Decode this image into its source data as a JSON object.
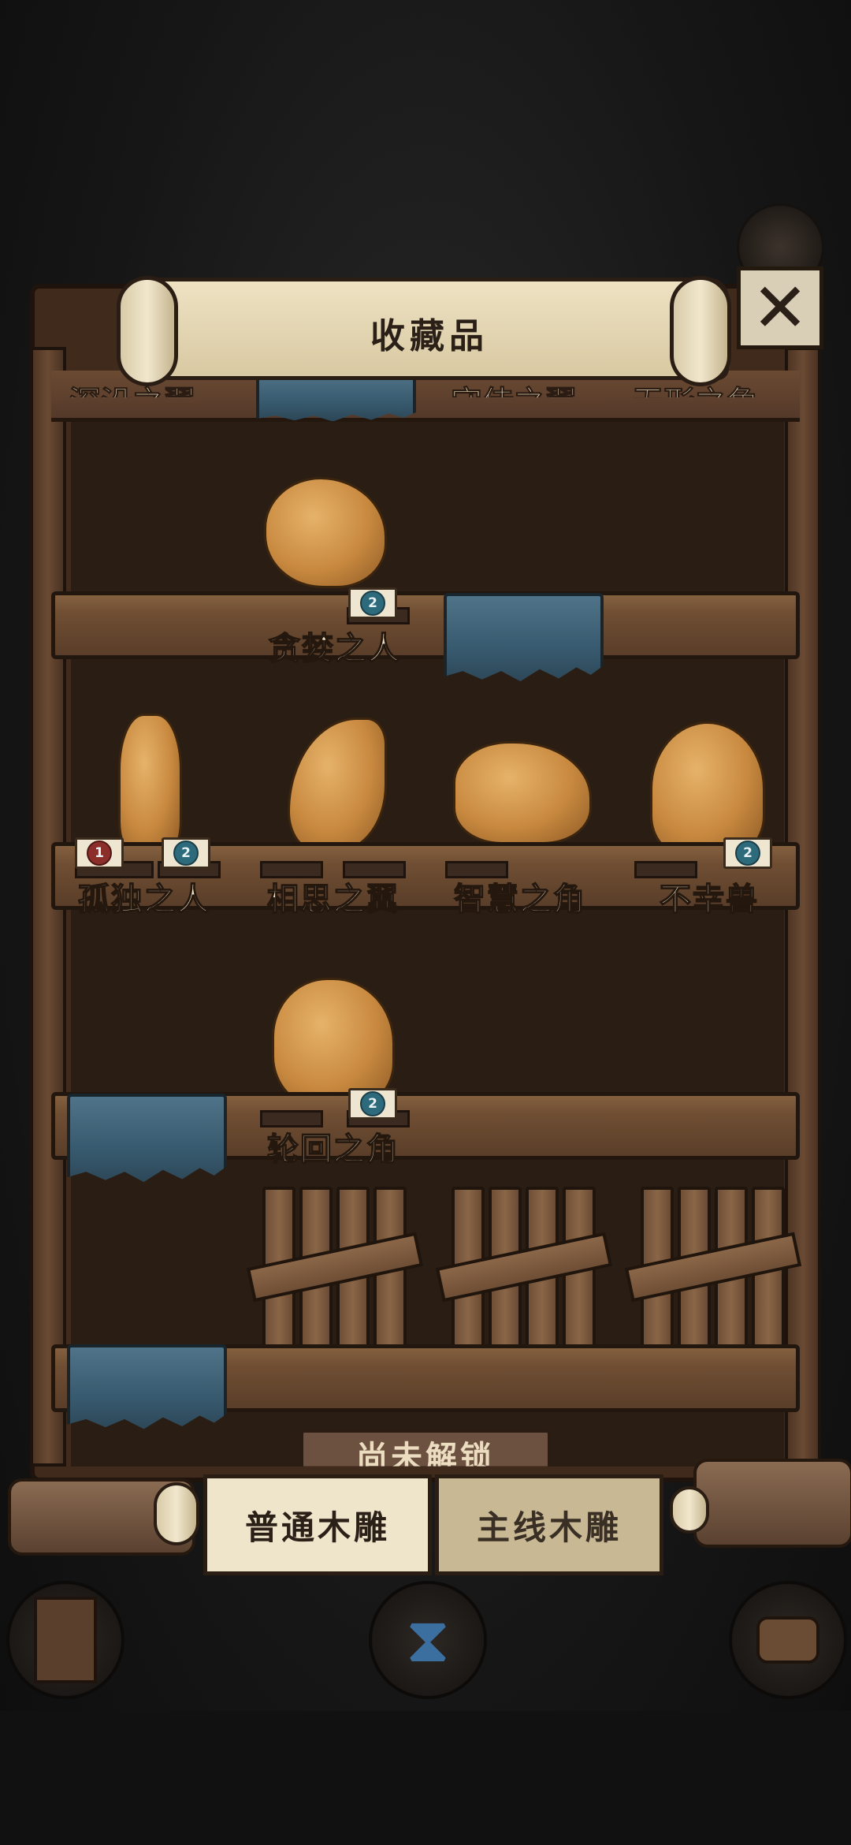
{
  "header": {
    "title": "收藏品",
    "close_icon": "close-x-icon"
  },
  "top_peek_labels": [
    "深沿之翼",
    "守侍之翼",
    "无形之角"
  ],
  "shelf_rows": [
    {
      "items": [
        {
          "label": "贪婪之人",
          "badges": [
            "2"
          ]
        }
      ]
    },
    {
      "items": [
        {
          "label": "孤独之人",
          "badges": [
            "1",
            "2"
          ]
        },
        {
          "label": "相思之翼",
          "badges": []
        },
        {
          "label": "智慧之角",
          "badges": []
        },
        {
          "label": "不幸兽",
          "badges": [
            "2"
          ]
        }
      ]
    },
    {
      "items": [
        {
          "label": "轮回之角",
          "badges": [
            "2"
          ]
        }
      ]
    }
  ],
  "locked_sign": "尚未解锁",
  "tabs": [
    {
      "label": "普通木雕",
      "active": true
    },
    {
      "label": "主线木雕",
      "active": false
    }
  ],
  "bottom_nav": {
    "left_icon": "door-icon",
    "center_icon": "hourglass-icon",
    "right_icon": "axe-stump-icon"
  },
  "colors": {
    "wood": "#6f4e33",
    "cloth": "#385a6f",
    "figure": "#c8893f",
    "parchment": "#efe5cb"
  }
}
